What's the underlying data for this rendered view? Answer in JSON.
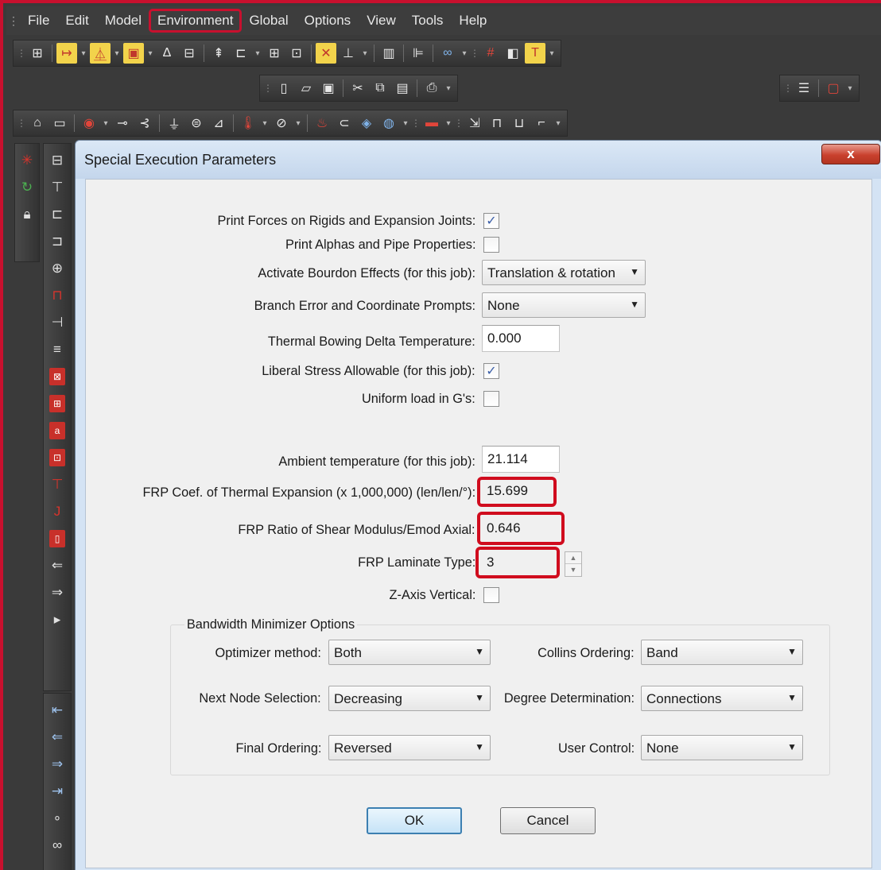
{
  "menu": {
    "items": [
      {
        "label": "File"
      },
      {
        "label": "Edit"
      },
      {
        "label": "Model"
      },
      {
        "label": "Environment",
        "highlighted": true
      },
      {
        "label": "Global"
      },
      {
        "label": "Options"
      },
      {
        "label": "View"
      },
      {
        "label": "Tools"
      },
      {
        "label": "Help"
      }
    ]
  },
  "toolbars": {
    "row1": [
      "grid-icon",
      "dimension-icon",
      "valve-icon",
      "monitor-icon",
      "delta-icon",
      "restraint-icon",
      "pipe-icon",
      "expansion-icon",
      "table-icon",
      "display-icon",
      "xyz-axis-icon",
      "anchor-icon",
      "list-icon",
      "flag-icon",
      "binoculars-icon",
      "hash-icon",
      "cube-icon",
      "hammer-icon"
    ],
    "row2": [
      "new-file-icon",
      "open-folder-icon",
      "save-icon",
      "cut-icon",
      "copy-icon",
      "paste-icon",
      "print-icon"
    ],
    "row3": [
      "edit-icon",
      "screen-icon",
      "flange-icon",
      "node-icon",
      "force-icon",
      "weight-icon",
      "stack-icon",
      "temperature-icon",
      "gauge-icon",
      "fire-icon",
      "cylinder-icon",
      "blue-pump-icon",
      "compressor-icon",
      "report-icon",
      "cursor-icon",
      "rect-icon"
    ],
    "far_right": [
      "list-view-icon",
      "document-icon"
    ]
  },
  "dialog": {
    "title": "Special Execution Parameters",
    "close_label": "x",
    "fields": {
      "print_forces_label": "Print Forces on Rigids and Expansion Joints:",
      "print_forces_checked": true,
      "print_alphas_label": "Print Alphas and Pipe Properties:",
      "print_alphas_checked": false,
      "bourdon_label": "Activate Bourdon Effects (for this job):",
      "bourdon_value": "Translation & rotation",
      "branch_error_label": "Branch Error and Coordinate Prompts:",
      "branch_error_value": "None",
      "thermal_bowing_label": "Thermal Bowing Delta Temperature:",
      "thermal_bowing_value": "0.000",
      "liberal_stress_label": "Liberal Stress Allowable (for this job):",
      "liberal_stress_checked": true,
      "uniform_load_label": "Uniform load in G's:",
      "uniform_load_checked": false,
      "ambient_temp_label": "Ambient temperature (for this job):",
      "ambient_temp_value": "21.114",
      "frp_coef_label": "FRP Coef. of Thermal Expansion (x 1,000,000) (len/len/°):",
      "frp_coef_value": "15.699",
      "frp_ratio_label": "FRP Ratio of Shear Modulus/Emod Axial:",
      "frp_ratio_value": "0.646",
      "frp_laminate_label": "FRP Laminate Type:",
      "frp_laminate_value": "3",
      "z_axis_label": "Z-Axis Vertical:",
      "z_axis_checked": false
    },
    "bandwidth": {
      "group_title": "Bandwidth Minimizer Options",
      "optimizer_label": "Optimizer method:",
      "optimizer_value": "Both",
      "collins_label": "Collins Ordering:",
      "collins_value": "Band",
      "next_node_label": "Next Node Selection:",
      "next_node_value": "Decreasing",
      "degree_label": "Degree Determination:",
      "degree_value": "Connections",
      "final_order_label": "Final Ordering:",
      "final_order_value": "Reversed",
      "user_control_label": "User Control:",
      "user_control_value": "None"
    },
    "buttons": {
      "ok_label": "OK",
      "cancel_label": "Cancel"
    }
  },
  "colors": {
    "highlight_red": "#d00c1e",
    "app_background": "#3a3a3a",
    "dialog_frame": "#d4e3f4",
    "client_area": "#f0f0f0"
  }
}
